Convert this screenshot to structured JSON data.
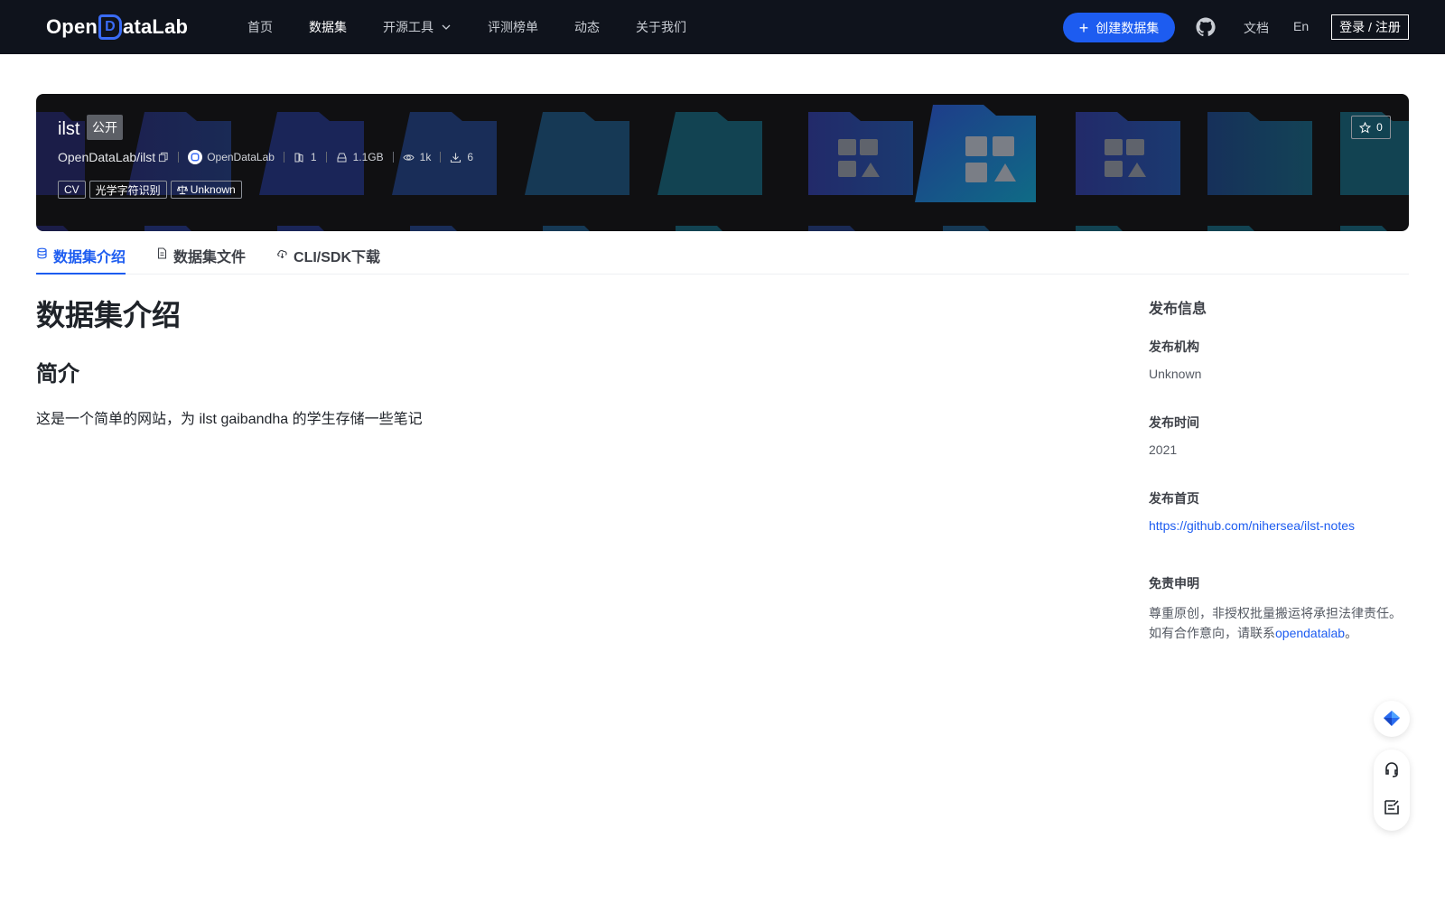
{
  "nav": {
    "logo_text_pre": "Open",
    "logo_text_d": "D",
    "logo_text_post": "ataLab",
    "links": [
      {
        "label": "首页"
      },
      {
        "label": "数据集"
      },
      {
        "label": "开源工具"
      },
      {
        "label": "评测榜单"
      },
      {
        "label": "动态"
      },
      {
        "label": "关于我们"
      }
    ],
    "active_link": "数据集",
    "create_label": "创建数据集",
    "docs_label": "文档",
    "lang_label": "En",
    "login_label": "登录 / 注册"
  },
  "dataset": {
    "title": "ilst",
    "visibility": "公开",
    "path": "OpenDataLab/ilst",
    "org": "OpenDataLab",
    "file_count": "1",
    "size": "1.1GB",
    "views": "1k",
    "downloads": "6",
    "tags": [
      "CV",
      "光学字符识别"
    ],
    "license": "Unknown",
    "stars": "0"
  },
  "tabs": [
    {
      "label": "数据集介绍",
      "icon": "database-icon"
    },
    {
      "label": "数据集文件",
      "icon": "file-icon"
    },
    {
      "label": "CLI/SDK下载",
      "icon": "cloud-download-icon"
    }
  ],
  "main": {
    "heading": "数据集介绍",
    "subheading": "简介",
    "description": "这是一个简单的网站，为 ilst gaibandha 的学生存储一些笔记"
  },
  "sidebar": {
    "title": "发布信息",
    "publisher_label": "发布机构",
    "publisher": "Unknown",
    "date_label": "发布时间",
    "date": "2021",
    "homepage_label": "发布首页",
    "homepage": "https://github.com/nihersea/ilst-notes",
    "disclaimer_label": "免责申明",
    "disclaimer_text": "尊重原创，非授权批量搬运将承担法律责任。如有合作意向，请联系",
    "disclaimer_link": "opendatalab",
    "disclaimer_end": "。"
  },
  "colors": {
    "nav_bg": "#0f131c",
    "accent": "#1d5cf0",
    "banner_bg": "#101012"
  }
}
